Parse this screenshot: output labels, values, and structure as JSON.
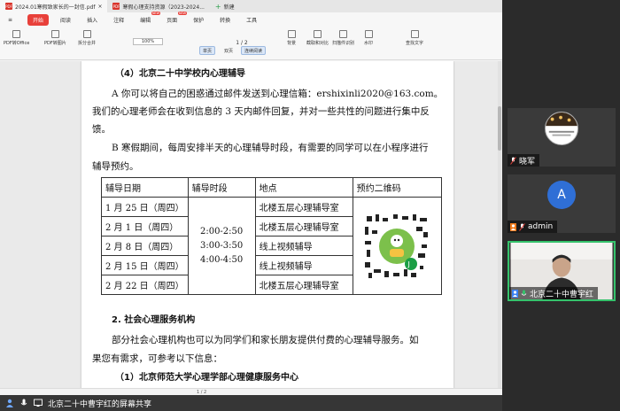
{
  "tabs": [
    {
      "label": "2024.01寒假致家长的一封信.pdf",
      "active": true
    },
    {
      "label": "寒假心理支持资源（2023-2024...",
      "active": false
    },
    {
      "label": "新建",
      "active": false
    }
  ],
  "menu": {
    "start": "开始",
    "items": [
      "阅读",
      "插入",
      "注释",
      "编辑",
      "页面",
      "保护",
      "转换",
      "工具"
    ],
    "badges": {
      "编辑": "NEW",
      "页面": "NEW"
    }
  },
  "toolbar": {
    "left_tools": [
      "PDF转Office",
      "PDF转图片",
      "拆分合并"
    ],
    "zoom": "100%",
    "page_indicator": "1 / 2",
    "views": [
      "单页",
      "双页",
      "连续阅读"
    ],
    "right_tools": [
      "背景",
      "截取和对比",
      "扫描件识别",
      "水印",
      "查找文字"
    ]
  },
  "document": {
    "section4_heading": "（4）北京二十中学校内心理辅导",
    "para_a_line1": "A 你可以将自己的困惑通过邮件发送到心理信箱：ershixinli2020@163.com。",
    "para_a_line2": "我们的心理老师会在收到信息的 3 天内邮件回复，并对一些共性的问题进行集中反",
    "para_a_line3": "馈。",
    "para_b_line1": "B 寒假期间，每周安排半天的心理辅导时段，有需要的同学可以在小程序进行",
    "para_b_line2": "辅导预约。",
    "table": {
      "headers": [
        "辅导日期",
        "辅导时段",
        "地点",
        "预约二维码"
      ],
      "dates": [
        "1 月 25 日（周四）",
        "2 月 1 日（周四）",
        "2 月 8 日（周四）",
        "2 月 15 日（周四）",
        "2 月 22 日（周四）"
      ],
      "time_slots": [
        "2:00-2:50",
        "3:00-3:50",
        "4:00-4:50"
      ],
      "locations": [
        "北楼五层心理辅导室",
        "北楼五层心理辅导室",
        "线上视频辅导",
        "线上视频辅导",
        "北楼五层心理辅导室"
      ]
    },
    "section2_heading": "2. 社会心理服务机构",
    "para_c_line1": "部分社会心理机构也可以为同学们和家长朋友提供付费的心理辅导服务。如",
    "para_c_line2": "果您有需求，可参考以下信息：",
    "sub1_heading": "（1）北京师范大学心理学部心理健康服务中心"
  },
  "status": {
    "page": "1 / 2"
  },
  "share_banner": "北京二十中曹宇红的屏幕共享",
  "participants": [
    {
      "name": "晓军",
      "type": "photo"
    },
    {
      "name": "admin",
      "initial": "A",
      "avatar_color": "#2f6fd6"
    },
    {
      "name": "北京二十中曹宇红",
      "type": "video",
      "active": true
    }
  ],
  "colors": {
    "accent_red": "#e8403a",
    "active_border": "#35c26b"
  }
}
